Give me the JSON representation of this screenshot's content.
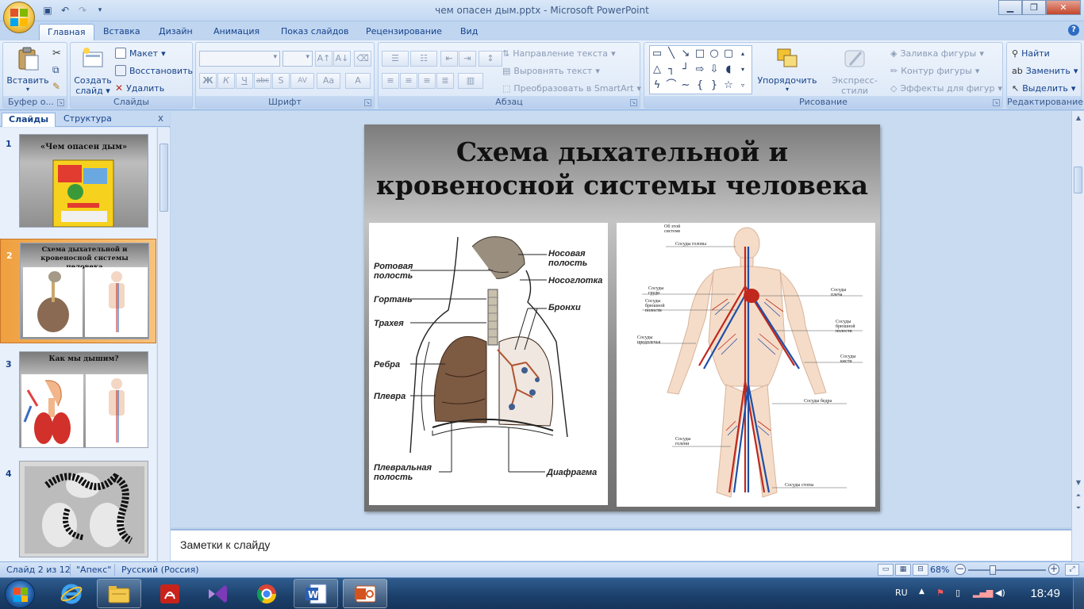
{
  "window": {
    "title": "чем опасен дым.pptx - Microsoft PowerPoint"
  },
  "ribbon": {
    "tabs": [
      "Главная",
      "Вставка",
      "Дизайн",
      "Анимация",
      "Показ слайдов",
      "Рецензирование",
      "Вид"
    ],
    "clipboard": {
      "paste": "Вставить",
      "label": "Буфер о..."
    },
    "slides": {
      "new_slide_line1": "Создать",
      "new_slide_line2": "слайд",
      "layout": "Макет",
      "reset": "Восстановить",
      "delete": "Удалить",
      "label": "Слайды"
    },
    "font": {
      "label": "Шрифт",
      "bold": "Ж",
      "italic": "К",
      "underline": "Ч",
      "strike": "abc",
      "shadow": "S",
      "spacing": "AV",
      "case": "Aa",
      "color": "A"
    },
    "paragraph": {
      "text_direction": "Направление текста",
      "align_text": "Выровнять текст",
      "smartart": "Преобразовать в SmartArt",
      "label": "Абзац"
    },
    "drawing": {
      "arrange": "Упорядочить",
      "quick_styles": "Экспресс-стили",
      "shape_fill": "Заливка фигуры",
      "shape_outline": "Контур фигуры",
      "shape_effects": "Эффекты для фигур",
      "label": "Рисование"
    },
    "editing": {
      "find": "Найти",
      "replace": "Заменить",
      "select": "Выделить",
      "label": "Редактирование"
    }
  },
  "left_panel": {
    "tabs": [
      "Слайды",
      "Структура"
    ],
    "close": "x",
    "thumbnails": [
      {
        "num": "1",
        "title": "«Чем опасен дым»"
      },
      {
        "num": "2",
        "title": "Схема дыхательной и кровеносной системы человека"
      },
      {
        "num": "3",
        "title": "Как мы дышим?"
      },
      {
        "num": "4",
        "title": ""
      }
    ]
  },
  "slide": {
    "title_line1": "Схема дыхательной и",
    "title_line2": "кровеносной системы человека",
    "resp_labels": {
      "nasal": "Носовая полость",
      "nasal_a": "Носовая",
      "nasal_b": "полость",
      "oral_a": "Ротовая",
      "oral_b": "полость",
      "pharynx": "Носоглотка",
      "larynx": "Гортань",
      "bronchi": "Бронхи",
      "trachea": "Трахея",
      "ribs": "Ребра",
      "pleura": "Плевра",
      "pleural_a": "Плевральная",
      "pleural_b": "полость",
      "diaphragm": "Диафрагма"
    },
    "circ_labels": {
      "about_a": "Об этой",
      "about_b": "системе",
      "head": "Сосуды головы",
      "chest_a": "Сосуды",
      "chest_b": "груди",
      "abdo_a": "Сосуды",
      "abdo_b": "брюшной",
      "abdo_c": "полости",
      "shoulder_a": "Сосуды",
      "shoulder_b": "плеча",
      "forearm_a": "Сосуды",
      "forearm_b": "предплечья",
      "abd2_a": "Сосуды",
      "abd2_b": "брюшной",
      "abd2_c": "полости",
      "hand_a": "Сосуды",
      "hand_b": "кисти",
      "thigh": "Сосуды бедра",
      "shin_a": "Сосуды",
      "shin_b": "голени",
      "foot": "Сосуды стопы"
    }
  },
  "notes": {
    "placeholder": "Заметки к слайду"
  },
  "status": {
    "slide_counter": "Слайд 2 из 12",
    "theme": "\"Апекс\"",
    "language": "Русский (Россия)",
    "zoom": "68%"
  },
  "taskbar": {
    "lang": "RU",
    "time": "18:49"
  },
  "colors": {
    "accent_selected_thumb": "#f0a040",
    "ribbon_bg": "#dbe8f8",
    "taskbar_bg": "#1b3f6a"
  }
}
